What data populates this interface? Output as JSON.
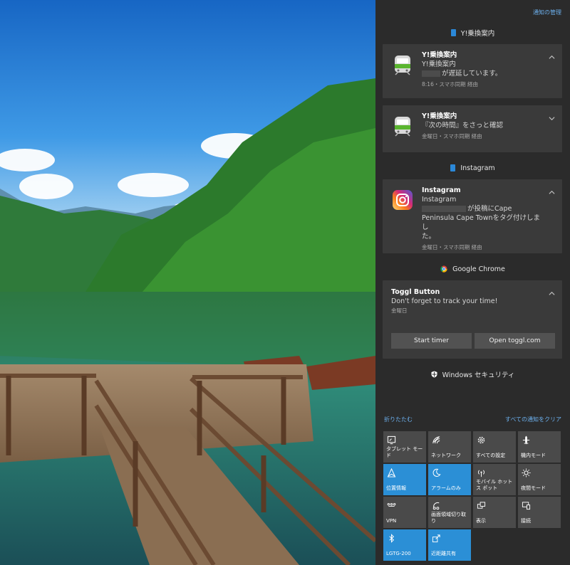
{
  "action_center": {
    "manage_label": "通知の管理",
    "groups": [
      {
        "app": "Y!乗換案内",
        "accent": "#2b88d8",
        "notifications": [
          {
            "title": "Y!乗換案内",
            "line1": "Y!乗換案内",
            "line2": "が遅延しています。",
            "meta": "8:16・スマホ同期 経由",
            "chevron": "up"
          },
          {
            "title": "Y!乗換案内",
            "line1": "『次の時間』をさっと確認",
            "meta": "金曜日・スマホ同期 経由",
            "chevron": "down"
          }
        ]
      },
      {
        "app": "Instagram",
        "accent": "#2b88d8",
        "notifications": [
          {
            "title": "Instagram",
            "line1": "Instagram",
            "line2": "が投稿にCape",
            "line3": "Peninsula Cape Townをタグ付けしまし",
            "line4": "た。",
            "meta": "金曜日・スマホ同期 経由",
            "chevron": "up"
          }
        ]
      },
      {
        "app": "Google Chrome",
        "notifications": [
          {
            "title": "Toggl Button",
            "line1": "Don't forget to track your time!",
            "meta": "金曜日",
            "chevron": "up",
            "actions": [
              "Start timer",
              "Open toggl.com"
            ]
          }
        ]
      },
      {
        "app": "Windows セキュリティ"
      }
    ],
    "collapse_label": "折りたたむ",
    "clear_all_label": "すべての通知をクリア",
    "quick_actions": [
      {
        "label": "タブレット モード",
        "icon": "tablet-mode-icon",
        "active": false
      },
      {
        "label": "ネットワーク",
        "icon": "network-icon",
        "active": false
      },
      {
        "label": "すべての設定",
        "icon": "settings-gear-icon",
        "active": false
      },
      {
        "label": "機内モード",
        "icon": "airplane-icon",
        "active": false
      },
      {
        "label": "位置情報",
        "icon": "location-icon",
        "active": true
      },
      {
        "label": "アラームのみ",
        "icon": "moon-icon",
        "active": true
      },
      {
        "label": "モバイル ホットス ポット",
        "icon": "hotspot-icon",
        "active": false
      },
      {
        "label": "夜間モード",
        "icon": "brightness-icon",
        "active": false
      },
      {
        "label": "VPN",
        "icon": "vpn-icon",
        "active": false
      },
      {
        "label": "画面領域切り取り",
        "icon": "snip-icon",
        "active": false
      },
      {
        "label": "表示",
        "icon": "project-icon",
        "active": false
      },
      {
        "label": "接続",
        "icon": "connect-icon",
        "active": false
      },
      {
        "label": "LGTG-200",
        "icon": "bluetooth-icon",
        "active": true
      },
      {
        "label": "近距離共有",
        "icon": "nearby-share-icon",
        "active": true
      }
    ],
    "colors": {
      "panel": "#2b2b2b",
      "card": "#3a3a3a",
      "link": "#6cb0ee",
      "tile": "#4a4a4a",
      "tile_active": "#2b8fd6"
    }
  }
}
